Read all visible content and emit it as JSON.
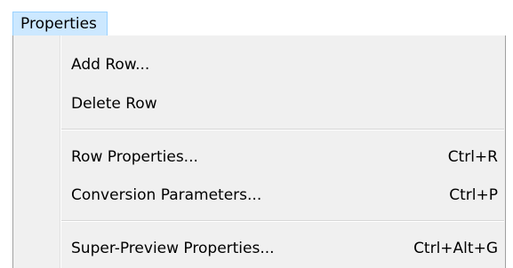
{
  "menubar": {
    "title": "Properties"
  },
  "menu": {
    "group1": [
      {
        "label": "Add Row...",
        "shortcut": ""
      },
      {
        "label": "Delete Row",
        "shortcut": ""
      }
    ],
    "group2": [
      {
        "label": "Row Properties...",
        "shortcut": "Ctrl+R"
      },
      {
        "label": "Conversion Parameters...",
        "shortcut": "Ctrl+P"
      }
    ],
    "group3": [
      {
        "label": "Super-Preview Properties...",
        "shortcut": "Ctrl+Alt+G"
      }
    ]
  },
  "colors": {
    "menu_background": "#f0f0f0",
    "highlight_background": "#cce8ff",
    "highlight_border": "#99d1ff"
  }
}
